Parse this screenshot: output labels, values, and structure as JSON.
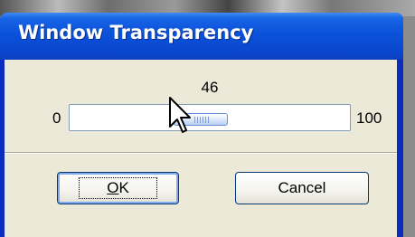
{
  "window": {
    "title": "Window Transparency"
  },
  "slider": {
    "value": "46",
    "min_label": "0",
    "max_label": "100",
    "value_fraction": 0.46
  },
  "buttons": {
    "ok": {
      "accesskey": "O",
      "rest": "K"
    },
    "cancel": "Cancel"
  },
  "colors": {
    "titlebar": "#0a52d9",
    "dialog_face": "#ece9d8",
    "button_border": "#003c74",
    "thumb": "#b9cff3"
  },
  "icons": {
    "cursor": "arrow-pointer"
  }
}
